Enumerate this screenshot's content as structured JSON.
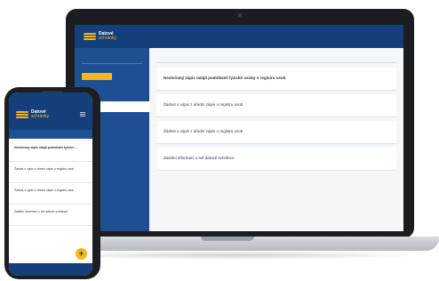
{
  "brand": {
    "name": "Datové",
    "subname": "schránky",
    "colors": {
      "primary": "#153f7a",
      "secondary": "#1d4f92",
      "accent": "#f3b81c"
    }
  },
  "laptop": {
    "header_title": "",
    "header_meta": [],
    "header_right": [],
    "sidebar": {
      "search_placeholder": "",
      "new_message_button": "",
      "items": [
        {
          "label": "",
          "active": false
        },
        {
          "label": "",
          "active": true
        },
        {
          "label": "",
          "active": false
        }
      ],
      "lower_items": [
        {
          "label": ""
        },
        {
          "label": ""
        },
        {
          "label": ""
        },
        {
          "label": ""
        }
      ]
    },
    "toolbar": {
      "left": "",
      "right": ""
    },
    "messages": [
      {
        "meta": "",
        "meta_right": "",
        "subject": "Neotvíraný zápis údajů podnikatel fyzické osoby o registru osob",
        "bold": true,
        "flag": ""
      },
      {
        "meta": "",
        "meta_right": "",
        "subject": "Žádost o výpis z úřední zápis o registru osob",
        "bold": false,
        "flag": ""
      },
      {
        "meta": "",
        "meta_right": "",
        "subject": "Žádost o výpis z úřední zápis o registru osob",
        "bold": false,
        "flag": ""
      },
      {
        "meta": "",
        "meta_right": "",
        "subject": "Zaslání informací o tvé datové schránce",
        "bold": false,
        "flag": ""
      }
    ]
  },
  "phone": {
    "subtitle": "",
    "messages": [
      {
        "meta": "",
        "subject": "Neotvíraný zápis údajů podnikatel fyzické...",
        "bold": true,
        "date": "",
        "flag": ""
      },
      {
        "meta": "",
        "subject": "Žádost o výpis z úřední zápis o registru osob",
        "bold": false,
        "date": "",
        "flag": ""
      },
      {
        "meta": "",
        "subject": "Žádost o výpis z úřední zápis o registru osob",
        "bold": false,
        "date": "",
        "flag": ""
      },
      {
        "meta": "",
        "subject": "Zaslání informací o tvé datové schránce",
        "bold": false,
        "date": "",
        "flag": ""
      }
    ],
    "footer_label": "",
    "fab_label": "+",
    "bottom_bar": ""
  },
  "icons": {
    "logo": "datove-schranky-logo-icon",
    "menu": "hamburger-menu-icon",
    "compose": "plus-icon"
  }
}
